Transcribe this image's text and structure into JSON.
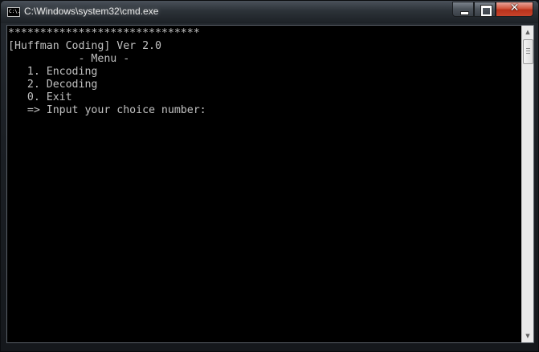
{
  "window": {
    "title": "C:\\Windows\\system32\\cmd.exe",
    "icon": "cmd-console-icon",
    "icon_text": "C:\\.",
    "controls": {
      "minimize_icon": "minimize-icon",
      "maximize_icon": "maximize-icon",
      "close_icon": "close-icon",
      "close_glyph": "✕"
    }
  },
  "console": {
    "lines": [
      "******************************",
      "[Huffman Coding] Ver 2.0",
      "           - Menu -",
      "   1. Encoding",
      "   2. Decoding",
      "   0. Exit",
      "   => Input your choice number:"
    ]
  },
  "scrollbar": {
    "up_arrow": "▲",
    "down_arrow": "▼"
  },
  "colors": {
    "console_bg": "#000000",
    "console_text": "#c0c0c0",
    "close_button": "#c7442c"
  }
}
